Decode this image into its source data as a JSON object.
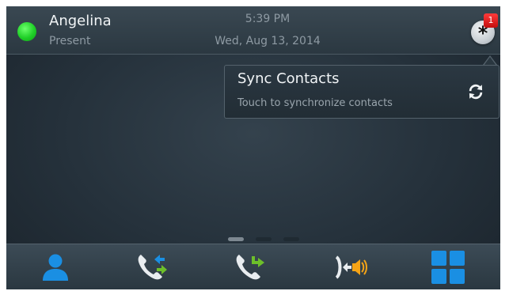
{
  "status_bar": {
    "user_name": "Angelina",
    "presence": "Present",
    "presence_color": "#22c92b",
    "time": "5:39 PM",
    "date": "Wed, Aug 13, 2014",
    "notification_icon": "asterisk-icon",
    "notification_count": "1"
  },
  "popup": {
    "title": "Sync Contacts",
    "subtitle": "Touch to synchronize contacts",
    "icon": "sync-icon"
  },
  "pager": {
    "page_count": 3,
    "current_page": 1
  },
  "dock": {
    "items": [
      {
        "name": "contacts",
        "icon": "person-icon"
      },
      {
        "name": "call-transfer",
        "icon": "phone-transfer-icon"
      },
      {
        "name": "call-forward",
        "icon": "phone-forward-icon"
      },
      {
        "name": "audio-source",
        "icon": "speaker-switch-icon"
      },
      {
        "name": "apps",
        "icon": "grid-apps-icon"
      }
    ]
  },
  "colors": {
    "accent_blue": "#1a8fe3",
    "green_arrow": "#6dbf2a",
    "orange": "#f5a416"
  }
}
